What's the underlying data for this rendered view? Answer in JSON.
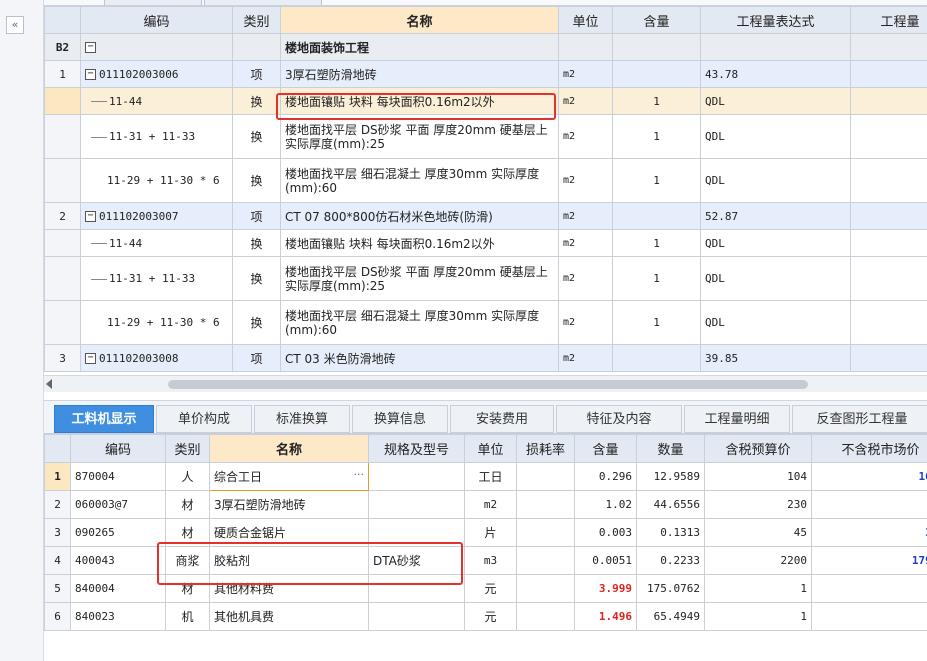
{
  "upper": {
    "headers": [
      "编码",
      "类别",
      "名称",
      "单位",
      "含量",
      "工程量表达式",
      "工程量"
    ],
    "group": {
      "id": "B2",
      "toggle": "−",
      "name": "楼地面装饰工程"
    },
    "rows": [
      {
        "rownum": "1",
        "toggle": "−",
        "code": "011102003006",
        "cat": "项",
        "name": "3厚石塑防滑地砖",
        "unit": "m2",
        "qty": "",
        "expr": "43.78",
        "amount": "4"
      },
      {
        "rownum": "",
        "code": "11-44",
        "cat": "换",
        "name": "楼地面镶贴 块料 每块面积0.16m2以外",
        "unit": "m2",
        "qty": "1",
        "expr": "QDL",
        "amount": "4"
      },
      {
        "rownum": "",
        "code": "11-31 + 11-33",
        "cat": "换",
        "name": "楼地面找平层 DS砂浆 平面 厚度20mm 硬基层上 实际厚度(mm):25",
        "unit": "m2",
        "qty": "1",
        "expr": "QDL",
        "amount": "4"
      },
      {
        "rownum": "",
        "code": "11-29 + 11-30 * 6",
        "cat": "换",
        "name": "楼地面找平层 细石混凝土 厚度30mm 实际厚度(mm):60",
        "unit": "m2",
        "qty": "1",
        "expr": "QDL",
        "amount": "4"
      },
      {
        "rownum": "2",
        "toggle": "−",
        "code": "011102003007",
        "cat": "项",
        "name": "CT 07 800*800仿石材米色地砖(防滑)",
        "unit": "m2",
        "qty": "",
        "expr": "52.87",
        "amount": "5"
      },
      {
        "rownum": "",
        "code": "11-44",
        "cat": "换",
        "name": "楼地面镶贴 块料 每块面积0.16m2以外",
        "unit": "m2",
        "qty": "1",
        "expr": "QDL",
        "amount": "5"
      },
      {
        "rownum": "",
        "code": "11-31 + 11-33",
        "cat": "换",
        "name": "楼地面找平层 DS砂浆 平面 厚度20mm 硬基层上 实际厚度(mm):25",
        "unit": "m2",
        "qty": "1",
        "expr": "QDL",
        "amount": "5"
      },
      {
        "rownum": "",
        "code": "11-29 + 11-30 * 6",
        "cat": "换",
        "name": "楼地面找平层 细石混凝土 厚度30mm 实际厚度(mm):60",
        "unit": "m2",
        "qty": "1",
        "expr": "QDL",
        "amount": "5"
      },
      {
        "rownum": "3",
        "toggle": "−",
        "code": "011102003008",
        "cat": "项",
        "name": "CT 03 米色防滑地砖",
        "unit": "m2",
        "qty": "",
        "expr": "39.85",
        "amount": "3"
      }
    ]
  },
  "bottom_tabs": [
    "工料机显示",
    "单价构成",
    "标准换算",
    "换算信息",
    "安装费用",
    "特征及内容",
    "工程量明细",
    "反查图形工程量"
  ],
  "lower": {
    "headers": [
      "编码",
      "类别",
      "名称",
      "规格及型号",
      "单位",
      "损耗率",
      "含量",
      "数量",
      "含税预算价",
      "不含税市场价"
    ],
    "rows": [
      {
        "rownum": "1",
        "code": "870004",
        "cat": "人",
        "name": "综合工日",
        "spec": "",
        "unit": "工日",
        "loss": "",
        "content": "0.296",
        "qty": "12.9589",
        "price": "104",
        "market": "163."
      },
      {
        "rownum": "2",
        "code": "060003@7",
        "cat": "材",
        "name": "3厚石塑防滑地砖",
        "spec": "",
        "unit": "m2",
        "loss": "",
        "content": "1.02",
        "qty": "44.6556",
        "price": "230",
        "market": "23"
      },
      {
        "rownum": "3",
        "code": "090265",
        "cat": "材",
        "name": "硬质合金锯片",
        "spec": "",
        "unit": "片",
        "loss": "",
        "content": "0.003",
        "qty": "0.1313",
        "price": "45",
        "market": "37."
      },
      {
        "rownum": "4",
        "code": "400043",
        "cat": "商浆",
        "name": "胶粘剂",
        "spec": "DTA砂浆",
        "unit": "m3",
        "loss": "",
        "content": "0.0051",
        "qty": "0.2233",
        "price": "2200",
        "market": "1795."
      },
      {
        "rownum": "5",
        "code": "840004",
        "cat": "材",
        "name": "其他材料费",
        "spec": "",
        "unit": "元",
        "loss": "",
        "content": "3.999",
        "qty": "175.0762",
        "price": "1",
        "market": ""
      },
      {
        "rownum": "6",
        "code": "840023",
        "cat": "机",
        "name": "其他机具费",
        "spec": "",
        "unit": "元",
        "loss": "",
        "content": "1.496",
        "qty": "65.4949",
        "price": "1",
        "market": ""
      }
    ],
    "ellipsis": "···"
  },
  "colors": {
    "highlight_red": "#e2322d",
    "tab_active": "#3f8ee0",
    "selected_row": "#fbefd7"
  }
}
